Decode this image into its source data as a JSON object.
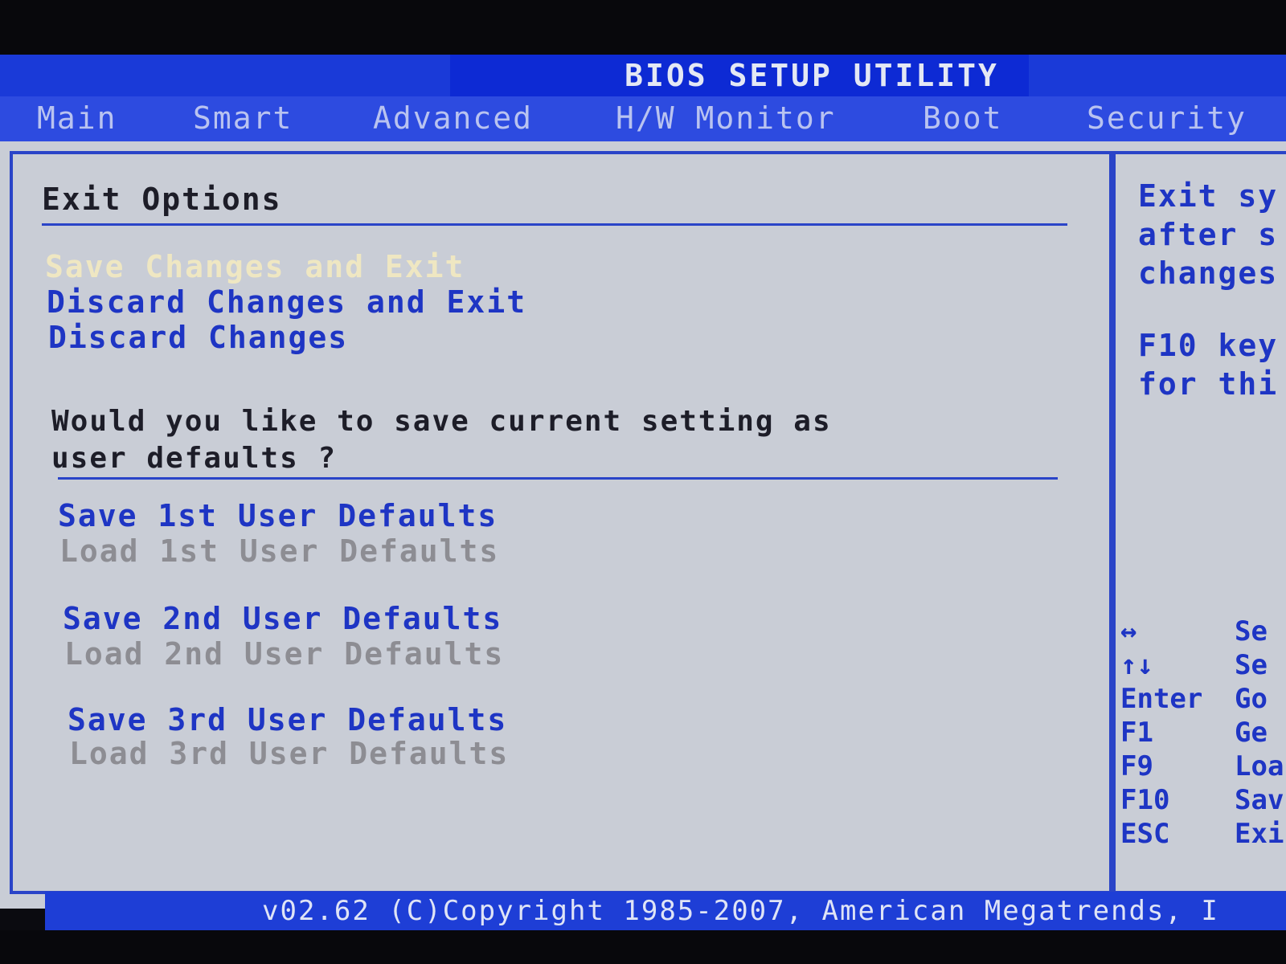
{
  "header": {
    "title": "BIOS SETUP UTILITY"
  },
  "menu": {
    "tabs": [
      {
        "label": "Main"
      },
      {
        "label": "Smart"
      },
      {
        "label": "Advanced"
      },
      {
        "label": "H/W Monitor"
      },
      {
        "label": "Boot"
      },
      {
        "label": "Security"
      }
    ]
  },
  "exit_panel": {
    "title": "Exit Options",
    "options": [
      {
        "label": "Save Changes and Exit",
        "state": "selected"
      },
      {
        "label": "Discard Changes and Exit",
        "state": "normal"
      },
      {
        "label": "Discard Changes",
        "state": "normal"
      }
    ],
    "question_line1": "Would you like to save current setting as",
    "question_line2": "user defaults ?",
    "user_defaults": [
      {
        "label": "Save 1st User Defaults",
        "state": "normal"
      },
      {
        "label": "Load 1st User Defaults",
        "state": "disabled"
      },
      {
        "label": "Save 2nd User Defaults",
        "state": "normal"
      },
      {
        "label": "Load 2nd User Defaults",
        "state": "disabled"
      },
      {
        "label": "Save 3rd User Defaults",
        "state": "normal"
      },
      {
        "label": "Load 3rd User Defaults",
        "state": "disabled"
      }
    ]
  },
  "help_panel": {
    "lines": [
      "Exit sy",
      "after s",
      "changes"
    ],
    "lines2": [
      "F10 key",
      "for thi"
    ]
  },
  "key_legend": [
    {
      "key": "↔",
      "desc": "Se"
    },
    {
      "key": "↑↓",
      "desc": "Se"
    },
    {
      "key": "Enter",
      "desc": "Go"
    },
    {
      "key": "F1",
      "desc": "Ge"
    },
    {
      "key": "F9",
      "desc": "Loa"
    },
    {
      "key": "F10",
      "desc": "Sav"
    },
    {
      "key": "ESC",
      "desc": "Exi"
    }
  ],
  "footer": {
    "copyright": "v02.62 (C)Copyright 1985-2007, American Megatrends, I"
  },
  "colors": {
    "title_bar": "#1a3ad8",
    "menu_bar": "#2d4be0",
    "panel_bg": "#c9cdd6",
    "border": "#2a44c8",
    "selected_text": "#efe7c2",
    "option_text": "#1e35c4",
    "disabled_text": "#8d8d93"
  }
}
